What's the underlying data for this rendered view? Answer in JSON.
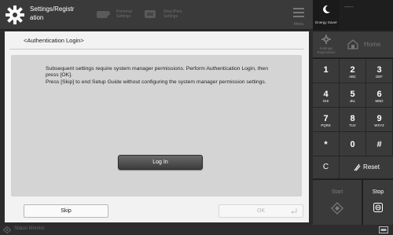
{
  "header": {
    "title_line1": "Settings/Registr",
    "title_line2": "ation",
    "tab_personal_line1": "Personal",
    "tab_personal_line2": "Settings",
    "tab_shared_line1": "Shar./Pers.",
    "tab_shared_line2": "Settings",
    "menu_label": "Menu"
  },
  "screen": {
    "title": "<Authentication Login>",
    "message_line1": "Subsequent settings require system manager permissions. Perform Authentication Login, then",
    "message_line2": "press [OK].",
    "message_line3": "Press [Skip] to end Setup Guide without configuring the system manager permission settings.",
    "login_label": "Log In",
    "skip_label": "Skip",
    "ok_label": "OK"
  },
  "statusbar": {
    "label": "Status Monitor",
    "icon": "counter-icon"
  },
  "panel": {
    "energy_saver": "Energy Saver",
    "dash": "-----",
    "settings_line1": "Settings/",
    "settings_line2": "Registration",
    "home": "Home",
    "keys": [
      {
        "num": "1",
        "sub": ""
      },
      {
        "num": "2",
        "sub": "ABC"
      },
      {
        "num": "3",
        "sub": "DEF"
      },
      {
        "num": "4",
        "sub": "GHI"
      },
      {
        "num": "5",
        "sub": "JKL"
      },
      {
        "num": "6",
        "sub": "MNO"
      },
      {
        "num": "7",
        "sub": "PQRS"
      },
      {
        "num": "8",
        "sub": "TUV"
      },
      {
        "num": "9",
        "sub": "WXYZ"
      },
      {
        "num": "*",
        "sub": ""
      },
      {
        "num": "0",
        "sub": ""
      },
      {
        "num": "#",
        "sub": ""
      }
    ],
    "clear": "C",
    "reset": "Reset",
    "start": "Start",
    "stop": "Stop"
  },
  "colors": {
    "topbar": "#3a3a3a",
    "content_bg": "#f2f2f2",
    "info_panel": "#d4d4d4",
    "keypad_bg": "#3a3a3a"
  }
}
